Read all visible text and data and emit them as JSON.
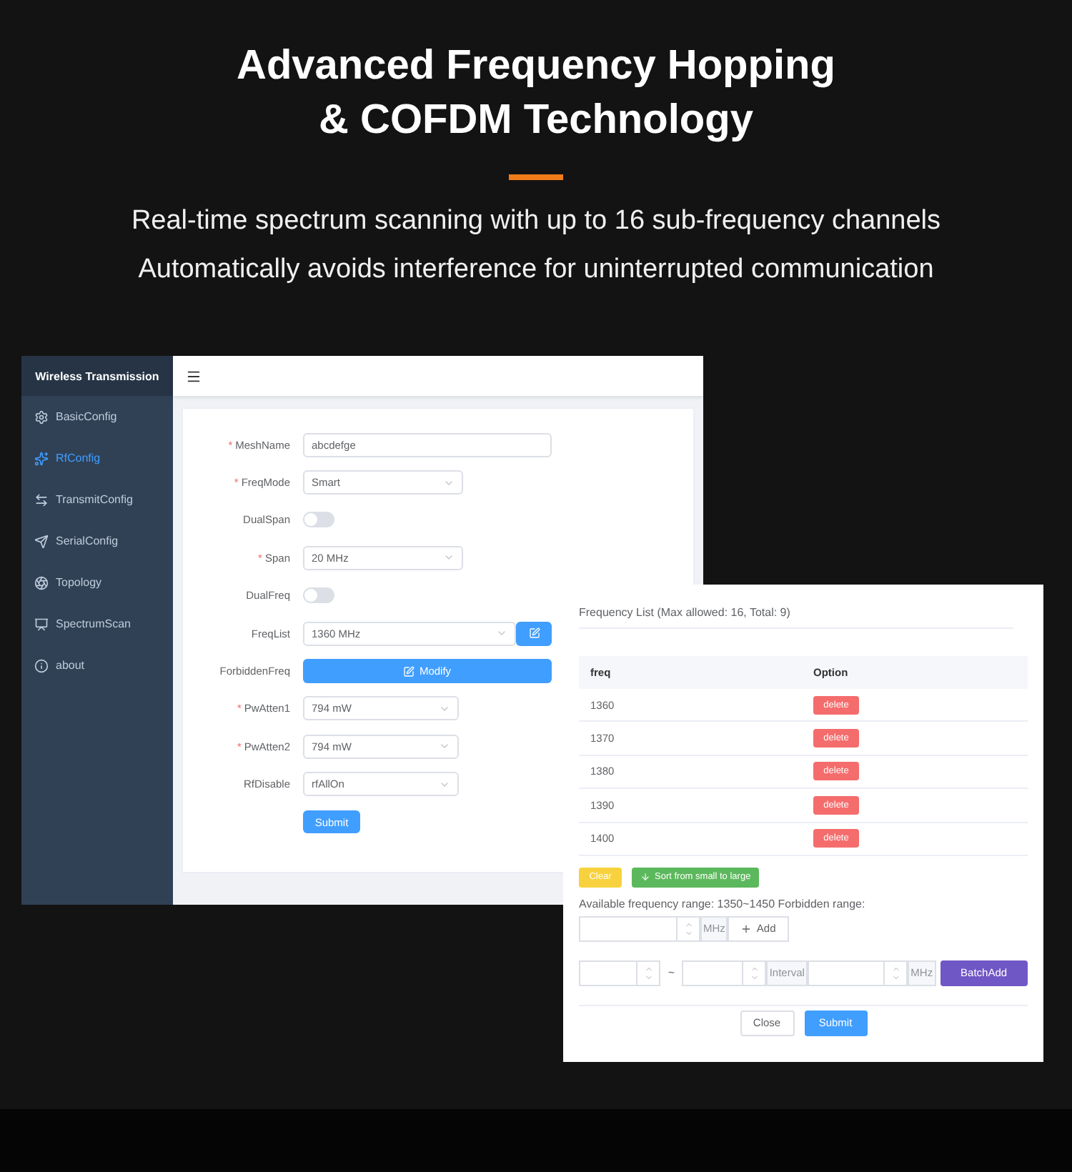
{
  "heading": {
    "title_lines": [
      "Advanced Frequency Hopping",
      "& COFDM Technology"
    ],
    "subtitles": [
      "Real-time spectrum scanning with up to 16 sub-frequency channels",
      "Automatically avoids interference for uninterrupted communication"
    ]
  },
  "app": {
    "sidebar": {
      "title": "Wireless Transmission",
      "items": [
        {
          "label": "BasicConfig",
          "selected": false
        },
        {
          "label": "RfConfig",
          "selected": true
        },
        {
          "label": "TransmitConfig",
          "selected": false
        },
        {
          "label": "SerialConfig",
          "selected": false
        },
        {
          "label": "Topology",
          "selected": false
        },
        {
          "label": "SpectrumScan",
          "selected": false
        },
        {
          "label": "about",
          "selected": false
        }
      ]
    },
    "form": {
      "fields": [
        {
          "kind": "input",
          "label": "MeshName",
          "required_mark": "*",
          "value": "abcdefge"
        },
        {
          "kind": "select",
          "label": "FreqMode",
          "required_mark": "*",
          "value": "Smart"
        },
        {
          "kind": "switch",
          "label": "DualSpan",
          "on": false
        },
        {
          "kind": "select",
          "label": "Span",
          "required_mark": "*",
          "value": "20 MHz"
        },
        {
          "kind": "switch",
          "label": "DualFreq",
          "on": false
        },
        {
          "kind": "list",
          "label": "FreqList",
          "value": "1360 MHz"
        },
        {
          "kind": "button",
          "label": "ForbiddenFreq",
          "value": "Modify"
        },
        {
          "kind": "select",
          "label": "PwAtten1",
          "required_mark": "*",
          "value": "794 mW"
        },
        {
          "kind": "select",
          "label": "PwAtten2",
          "required_mark": "*",
          "value": "794 mW"
        },
        {
          "kind": "select",
          "label": "RfDisable",
          "value": "rfAllOn"
        }
      ],
      "submit": "Submit"
    }
  },
  "dialog": {
    "title": "Frequency List (Max allowed: 16, Total: 9)",
    "columns": [
      "freq",
      "Option"
    ],
    "rows": [
      {
        "freq": "1360",
        "action": "delete"
      },
      {
        "freq": "1370",
        "action": "delete"
      },
      {
        "freq": "1380",
        "action": "delete"
      },
      {
        "freq": "1390",
        "action": "delete"
      },
      {
        "freq": "1400",
        "action": "delete"
      }
    ],
    "clear": "Clear",
    "sort": "Sort from small to large",
    "range_text": "Available frequency range: 1350~1450 Forbidden range:",
    "add_unit": "MHz",
    "add": "Add",
    "batch": {
      "separator": "~",
      "interval": "Interval",
      "unit": "MHz",
      "button": "BatchAdd"
    },
    "footer": {
      "close": "Close",
      "submit": "Submit"
    }
  }
}
